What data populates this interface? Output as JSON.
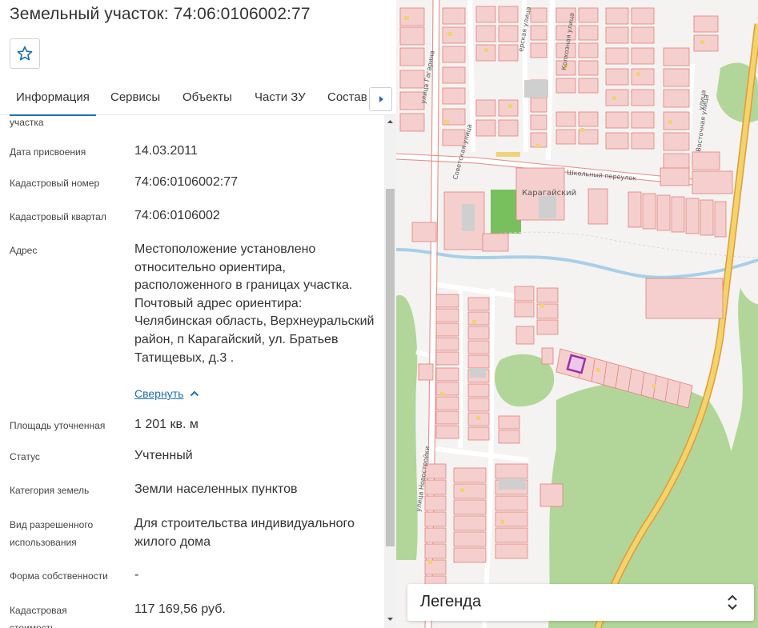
{
  "header": {
    "title": "Земельный участок: 74:06:0106002:77"
  },
  "tabs": [
    {
      "label": "Информация"
    },
    {
      "label": "Сервисы"
    },
    {
      "label": "Объекты"
    },
    {
      "label": "Части ЗУ"
    },
    {
      "label": "Состав"
    }
  ],
  "info": {
    "cut_label": "участка",
    "rows": [
      {
        "label": "Дата присвоения",
        "value": "14.03.2011"
      },
      {
        "label": "Кадастровый номер",
        "value": "74:06:0106002:77"
      },
      {
        "label": "Кадастровый квартал",
        "value": "74:06:0106002"
      },
      {
        "label": "Адрес",
        "value": "Местоположение установлено относительно ориентира, расположенного в границах участка. Почтовый адрес ориентира: Челябинская область, Верхнеуральский район, п Карагайский, ул. Братьев Татищевых, д.3 ."
      },
      {
        "label": "Площадь уточненная",
        "value": "1 201 кв. м"
      },
      {
        "label": "Статус",
        "value": "Учтенный"
      },
      {
        "label": "Категория земель",
        "value": "Земли населенных пунктов"
      },
      {
        "label": "Вид разрешенного использования",
        "value": "Для строительства индивидуального жилого дома"
      },
      {
        "label": "Форма собственности",
        "value": "-"
      },
      {
        "label": "Кадастровая стоимость",
        "value": "117 169,56 руб."
      }
    ],
    "collapse_label": "Свернуть"
  },
  "map": {
    "labels": {
      "village": "Карагайский",
      "school_lane": "Школьный переулок",
      "gagarin": "улица Гагарина",
      "sovetskaya": "Советская улица",
      "kolkhoznaya": "Колхозная улица",
      "vostochnaya": "Восточная улица",
      "street_north": "улица",
      "pionerskaya": "ерская улица",
      "novostroyki": "улица Новостройки"
    }
  },
  "legend": {
    "title": "Легенда"
  },
  "colors": {
    "accent": "#1f6fb8",
    "parcel_fill": "#f5cfcd",
    "parcel_stroke": "#e0807c",
    "green": "#a8d08d",
    "selected_parcel": "#9b2fa8",
    "river": "#a9cfe8",
    "highway": "#f0c552"
  }
}
